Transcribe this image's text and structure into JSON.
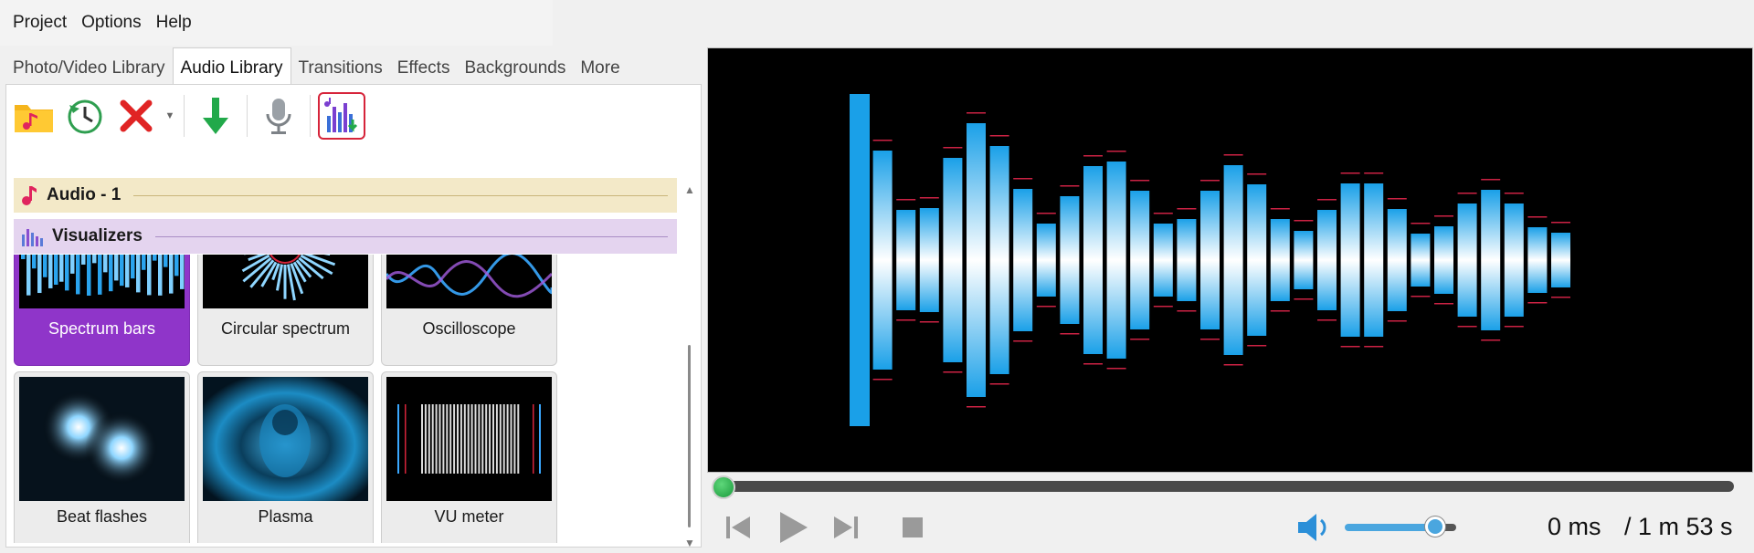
{
  "menu": {
    "items": [
      "Project",
      "Options",
      "Help"
    ]
  },
  "tabs": [
    "Photo/Video Library",
    "Audio Library",
    "Transitions",
    "Effects",
    "Backgrounds",
    "More"
  ],
  "active_tab_index": 1,
  "toolbar": {
    "buttons": [
      {
        "icon": "folder-music-icon"
      },
      {
        "icon": "recent-clock-icon"
      },
      {
        "icon": "delete-x-icon"
      },
      {
        "icon": "dropdown-arrow-icon"
      },
      {
        "icon": "download-arrow-icon"
      },
      {
        "icon": "microphone-icon"
      },
      {
        "icon": "audio-visualizer-icon",
        "selected": true
      }
    ]
  },
  "groups": {
    "audio": {
      "label": "Audio - 1",
      "icon": "music-note-icon"
    },
    "visualizers": {
      "label": "Visualizers",
      "icon": "visualizer-bars-icon"
    }
  },
  "visualizers": [
    {
      "label": "Spectrum bars",
      "selected": true
    },
    {
      "label": "Circular spectrum",
      "selected": false
    },
    {
      "label": "Oscilloscope",
      "selected": false
    },
    {
      "label": "Beat flashes",
      "selected": false
    },
    {
      "label": "Plasma",
      "selected": false
    },
    {
      "label": "VU meter",
      "selected": false
    }
  ],
  "player": {
    "current_time": "0 ms",
    "total_time": "/ 1 m 53 s",
    "seek_progress": 0,
    "volume_level": 0.8,
    "controls": [
      "previous-frame-icon",
      "play-icon",
      "next-frame-icon",
      "stop-icon",
      "speaker-icon"
    ]
  },
  "colors": {
    "accent": "#8f35c9",
    "bar_top": "#1aa0e8",
    "bar_mid": "#ffffff",
    "peak_marker": "#cc2244",
    "audio_group_bg": "#f3e9c8",
    "visualizer_group_bg": "#e4d4ef"
  }
}
